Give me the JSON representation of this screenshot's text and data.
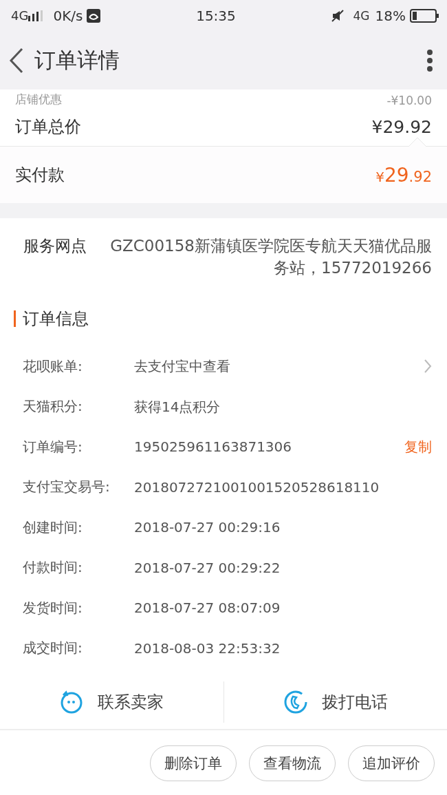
{
  "status_bar": {
    "network": "4G",
    "speed": "0K/s",
    "time": "15:35",
    "data": "4G",
    "battery": "18%"
  },
  "header": {
    "title": "订单详情"
  },
  "summary": {
    "discount": {
      "label": "店铺优惠",
      "value": "-¥10.00"
    },
    "total": {
      "label": "订单总价",
      "value": "¥29.92"
    },
    "paid": {
      "label": "实付款",
      "symbol": "¥",
      "integer": "29",
      "decimal": ".92"
    }
  },
  "service": {
    "label": "服务网点",
    "value": "GZC00158新蒲镇医学院医专航天天猫优品服务站，15772019266"
  },
  "order_info": {
    "title": "订单信息",
    "rows": [
      {
        "kind": "link",
        "label": "花呗账单:",
        "value": "去支付宝中查看"
      },
      {
        "kind": "plain",
        "label": "天猫积分:",
        "value": "获得14点积分"
      },
      {
        "kind": "copy",
        "label": "订单编号:",
        "value": "195025961163871306",
        "action": "复制"
      },
      {
        "kind": "plain",
        "label": "支付宝交易号:",
        "value": "2018072721001001520528618110"
      },
      {
        "kind": "plain",
        "label": "创建时间:",
        "value": "2018-07-27 00:29:16"
      },
      {
        "kind": "plain",
        "label": "付款时间:",
        "value": "2018-07-27 00:29:22"
      },
      {
        "kind": "plain",
        "label": "发货时间:",
        "value": "2018-07-27 08:07:09"
      },
      {
        "kind": "plain",
        "label": "成交时间:",
        "value": "2018-08-03 22:53:32"
      }
    ]
  },
  "contact": [
    {
      "kind": "chat",
      "label": "联系卖家"
    },
    {
      "kind": "phone",
      "label": "拨打电话"
    }
  ],
  "buttons": [
    "删除订单",
    "查看物流",
    "追加评价"
  ]
}
